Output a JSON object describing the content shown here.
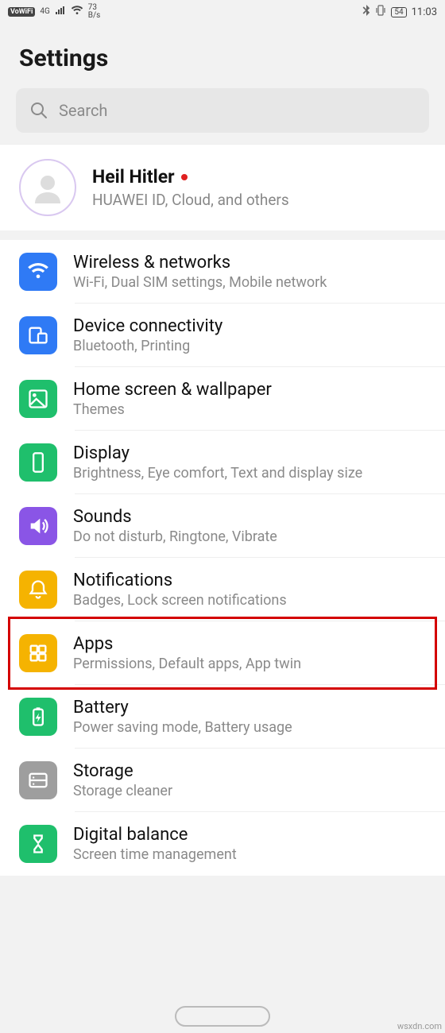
{
  "status": {
    "vowifi": "VoWiFi",
    "net_type": "4G",
    "speed_num": "73",
    "speed_unit": "B/s",
    "battery": "54",
    "time": "11:03"
  },
  "header": {
    "title": "Settings"
  },
  "search": {
    "placeholder": "Search"
  },
  "account": {
    "name": "Heil Hitler",
    "subtitle": "HUAWEI ID, Cloud, and others"
  },
  "items": [
    {
      "title": "Wireless & networks",
      "subtitle": "Wi-Fi, Dual SIM settings, Mobile network",
      "icon": "wifi",
      "color": "#2f7af5"
    },
    {
      "title": "Device connectivity",
      "subtitle": "Bluetooth, Printing",
      "icon": "devices",
      "color": "#2f7af5"
    },
    {
      "title": "Home screen & wallpaper",
      "subtitle": "Themes",
      "icon": "picture",
      "color": "#1fbf6c"
    },
    {
      "title": "Display",
      "subtitle": "Brightness, Eye comfort, Text and display size",
      "icon": "phone",
      "color": "#1fbf6c"
    },
    {
      "title": "Sounds",
      "subtitle": "Do not disturb, Ringtone, Vibrate",
      "icon": "sound",
      "color": "#8a55e6"
    },
    {
      "title": "Notifications",
      "subtitle": "Badges, Lock screen notifications",
      "icon": "bell",
      "color": "#f5b301"
    },
    {
      "title": "Apps",
      "subtitle": "Permissions, Default apps, App twin",
      "icon": "apps",
      "color": "#f5b301"
    },
    {
      "title": "Battery",
      "subtitle": "Power saving mode, Battery usage",
      "icon": "battery",
      "color": "#1fbf6c"
    },
    {
      "title": "Storage",
      "subtitle": "Storage cleaner",
      "icon": "storage",
      "color": "#9e9e9e"
    },
    {
      "title": "Digital balance",
      "subtitle": "Screen time management",
      "icon": "hourglass",
      "color": "#1fbf6c"
    }
  ],
  "highlight_index": 6,
  "watermark": "wsxdn.com"
}
